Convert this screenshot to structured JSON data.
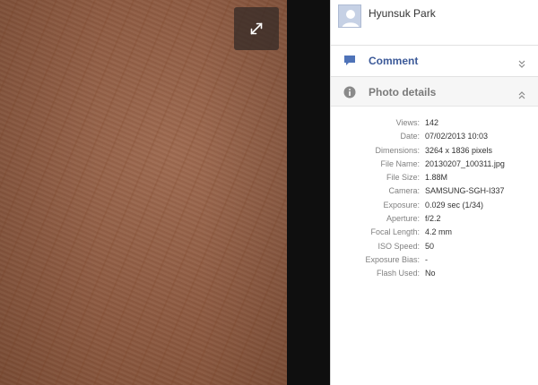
{
  "owner": {
    "name": "Hyunsuk Park"
  },
  "sections": {
    "comment": {
      "label": "Comment",
      "icon": "comment-icon",
      "chevron": "chevron-double-down-icon"
    },
    "details": {
      "label": "Photo details",
      "icon": "info-icon",
      "chevron": "chevron-double-up-icon"
    }
  },
  "details": [
    {
      "key": "Views:",
      "value": "142"
    },
    {
      "key": "Date:",
      "value": "07/02/2013 10:03"
    },
    {
      "key": "Dimensions:",
      "value": "3264 x 1836 pixels"
    },
    {
      "key": "File Name:",
      "value": "20130207_100311.jpg"
    },
    {
      "key": "File Size:",
      "value": "1.88M"
    },
    {
      "key": "Camera:",
      "value": "SAMSUNG-SGH-I337"
    },
    {
      "key": "Exposure:",
      "value": "0.029 sec (1/34)"
    },
    {
      "key": "Aperture:",
      "value": "f/2.2"
    },
    {
      "key": "Focal Length:",
      "value": "4.2 mm"
    },
    {
      "key": "ISO Speed:",
      "value": "50"
    },
    {
      "key": "Exposure Bias:",
      "value": "-"
    },
    {
      "key": "Flash Used:",
      "value": "No"
    }
  ],
  "viewer": {
    "expand_icon": "expand-icon"
  },
  "colors": {
    "link_blue": "#3b5998",
    "panel_bg": "#ffffff",
    "gutter": "#0f0f0f",
    "photo_skin": "#8c5a42"
  }
}
